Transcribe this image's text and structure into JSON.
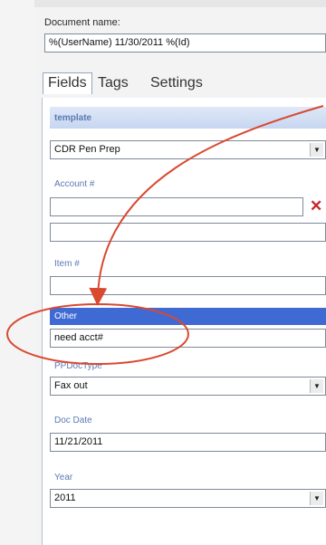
{
  "document": {
    "label": "Document name:",
    "value": "%(UserName) 11/30/2011 %(Id)"
  },
  "tabs": [
    {
      "label": "Fields",
      "active": true
    },
    {
      "label": "Tags",
      "active": false
    },
    {
      "label": "Settings",
      "active": false
    }
  ],
  "fields": {
    "template": {
      "label": "template",
      "value": "CDR Pen Prep"
    },
    "account": {
      "label": "Account #",
      "value": "",
      "second_value": ""
    },
    "item": {
      "label": "Item #",
      "value": ""
    },
    "other": {
      "label": "Other",
      "value": "need acct#"
    },
    "pp_doc_type": {
      "label": "PPDocType",
      "value": "Fax out"
    },
    "doc_date": {
      "label": "Doc Date",
      "value": "11/21/2011"
    },
    "year": {
      "label": "Year",
      "value": "2011"
    }
  },
  "colors": {
    "accent": "#3f6ad4",
    "annotation": "#d9492f",
    "delete": "#c8272b"
  },
  "icons": {
    "clear": "x-icon",
    "dropdown": "chevron-down-icon"
  }
}
